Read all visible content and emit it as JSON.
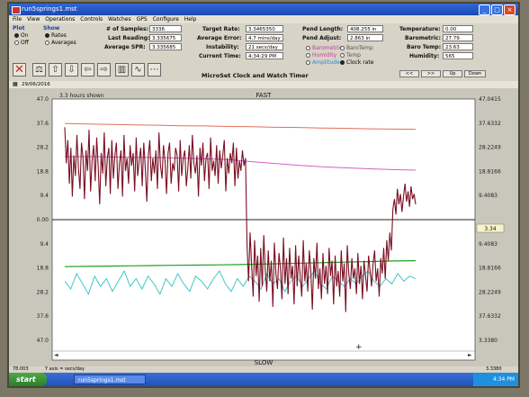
{
  "window": {
    "title": "run5springs1.mst"
  },
  "menu": [
    "File",
    "View",
    "Operations",
    "Controls",
    "Watches",
    "GPS",
    "Configure",
    "Help"
  ],
  "plot_group": {
    "label": "Plot",
    "options": [
      {
        "label": "On",
        "selected": true
      },
      {
        "label": "Off",
        "selected": false
      }
    ]
  },
  "show_group": {
    "label": "Show",
    "options": [
      {
        "label": "Rates",
        "selected": true
      },
      {
        "label": "Averages",
        "selected": false
      }
    ]
  },
  "stats": {
    "samples_label": "# of Samples:",
    "samples": "3336",
    "last_reading_label": "Last Reading:",
    "last_reading": "3.335675",
    "avg_spr_label": "Average SPR:",
    "avg_spr": "3.335685",
    "target_rate_label": "Target Rate:",
    "target_rate": "3.3465350",
    "avg_error_label": "Average Error:",
    "avg_error": "4.7 mins/day",
    "instability_label": "Instability:",
    "instability": "21 secs/day",
    "current_time_label": "Current Time:",
    "current_time": "4:34:29 PM",
    "pend_length_label": "Pend Length:",
    "pend_length": "408.255 in",
    "pend_adjust_label": "Pend Adjust:",
    "pend_adjust": "2.863 in",
    "temperature_label": "Temperature:",
    "temperature": "0.00",
    "barometric_label": "Barometric:",
    "barometric": "27.79",
    "baro_temp_label": "Baro Temp:",
    "baro_temp": "23.63",
    "humidity_label": "Humidity:",
    "humidity": "565"
  },
  "center_title": "MicroSet Clock and Watch Timer",
  "series_options": [
    {
      "label": "Barometric",
      "color": "#c0409a",
      "selected": false
    },
    {
      "label": "BaroTemp",
      "color": "#555555",
      "selected": false
    },
    {
      "label": "Humidity",
      "color": "#c0409a",
      "selected": false
    },
    {
      "label": "Temp",
      "color": "#555555",
      "selected": false
    },
    {
      "label": "Amplitude",
      "color": "#2a8ad0",
      "selected": false
    },
    {
      "label": "Clock rate",
      "color": "#111111",
      "selected": true
    }
  ],
  "nav_buttons": [
    "<<",
    ">>",
    "Up",
    "Down"
  ],
  "date": "29/06/2016",
  "chart_header": {
    "hours_shown": "3.3 hours shown",
    "top_label": "FAST",
    "bottom_label": "SLOW",
    "right_value": "3.34",
    "footer_left": "78.003",
    "footer_mid": "Y axis = secs/day",
    "footer_right": "3.3380"
  },
  "taskbar": {
    "start": "start",
    "task": "run5springs1.mst",
    "clock": "4:34 PM"
  },
  "chart_data": {
    "type": "line",
    "y_left_ticks": [
      "47.0",
      "37.6",
      "28.2",
      "18.8",
      "9.4",
      "0.00",
      "9.4",
      "18.8",
      "28.2",
      "37.6",
      "47.0"
    ],
    "y_right_ticks": [
      "47.0415",
      "37.6332",
      "28.2249",
      "18.8166",
      "9.4083",
      "3.34",
      "9.4083",
      "18.8166",
      "28.2249",
      "37.6332",
      "3.3380"
    ],
    "ylim": [
      -47,
      47
    ],
    "xlim": [
      0,
      3.3
    ],
    "grid": false,
    "series": [
      {
        "color": "#7a0f22",
        "values": [
          36,
          22,
          31,
          14,
          28,
          9,
          25,
          17,
          33,
          20,
          12,
          30,
          24,
          8,
          27,
          19,
          35,
          11,
          23,
          29,
          15,
          32,
          21,
          6,
          26,
          18,
          34,
          13,
          24,
          28,
          10,
          31,
          16,
          25,
          30,
          12,
          22,
          27,
          9,
          33,
          19,
          24,
          14,
          29,
          21,
          26,
          11,
          32,
          17,
          23,
          28,
          13,
          30,
          20,
          7,
          25,
          31,
          15,
          24,
          18,
          27,
          12,
          34,
          21,
          16,
          29,
          23,
          10,
          26,
          30,
          14,
          22,
          19,
          28,
          25,
          11,
          31,
          17,
          24,
          27,
          13,
          20,
          29,
          16,
          33,
          22,
          18,
          25,
          9,
          28,
          21,
          30,
          15,
          24,
          26,
          12,
          32,
          19,
          23,
          17,
          29,
          14,
          27,
          20,
          25,
          31,
          11,
          24,
          18,
          26,
          22,
          30,
          13,
          28,
          16,
          23,
          19,
          27,
          21,
          24,
          -10,
          -24,
          -5,
          -18,
          -30,
          -8,
          -22,
          -14,
          -32,
          -11,
          -26,
          -6,
          -20,
          -28,
          -12,
          -24,
          -16,
          -34,
          -9,
          -21,
          -27,
          -13,
          -19,
          -31,
          -7,
          -25,
          -15,
          -29,
          -11,
          -23,
          -18,
          -33,
          -10,
          -26,
          -14,
          -22,
          -30,
          -8,
          -24,
          -17,
          -28,
          -12,
          -20,
          -35,
          -15,
          -23,
          -9,
          -27,
          -19,
          -31,
          -13,
          -25,
          -18,
          -29,
          -11,
          -22,
          -16,
          -33,
          -14,
          -26,
          -20,
          -30,
          -12,
          -24,
          -17,
          -36,
          -10,
          -21,
          -27,
          -15,
          -23,
          -19,
          -29,
          -13,
          -25,
          -18,
          -31,
          -16,
          -22,
          -28,
          -14,
          -20,
          -26,
          -17,
          -12,
          -24,
          -19,
          -30,
          -15,
          -21,
          -11,
          -23,
          -8,
          -16,
          -5,
          -12,
          4,
          8,
          2,
          12,
          6,
          10,
          3,
          9,
          14,
          7,
          11,
          5,
          13,
          8,
          10,
          6
        ]
      },
      {
        "color": "#e0705a",
        "values": [
          37.5,
          37.3,
          37.1,
          36.9,
          36.8,
          36.6,
          36.5,
          36.3,
          36.2,
          36.0,
          35.9,
          35.7,
          35.6,
          35.4,
          35.3,
          35.2
        ]
      },
      {
        "color": "#d060c8",
        "values": [
          24.5,
          24.6,
          24.4,
          24.3,
          24.2,
          24.0,
          23.7,
          23.4,
          22.6,
          21.9,
          21.2,
          20.6,
          20.2,
          19.8,
          19.5,
          19.3
        ]
      },
      {
        "color": "#20a020",
        "values": [
          -18.3,
          -18.2,
          -18.1,
          -18.0,
          -17.9,
          -17.8,
          -17.7,
          -17.6,
          -17.5,
          -17.3,
          -17.1,
          -16.9,
          -16.7,
          -16.5,
          -16.3,
          -16.1,
          -16.0
        ]
      },
      {
        "color": "#40c8c8",
        "values": [
          -24,
          -27,
          -21,
          -25,
          -29,
          -22,
          -26,
          -23,
          -28,
          -24,
          -20,
          -26,
          -23,
          -27,
          -22,
          -25,
          -29,
          -23,
          -26,
          -21,
          -25,
          -28,
          -22,
          -24,
          -27,
          -23,
          -20,
          -25,
          -28,
          -23,
          -26,
          -22,
          -24,
          -27,
          -21,
          -25,
          -23,
          -28,
          -24,
          -22,
          -26,
          -23,
          -20,
          -25,
          -27,
          -22,
          -24,
          -26,
          -23,
          -25,
          -22,
          -20,
          -24,
          -26,
          -23,
          -25,
          -21,
          -24,
          -22,
          -23
        ]
      }
    ]
  }
}
